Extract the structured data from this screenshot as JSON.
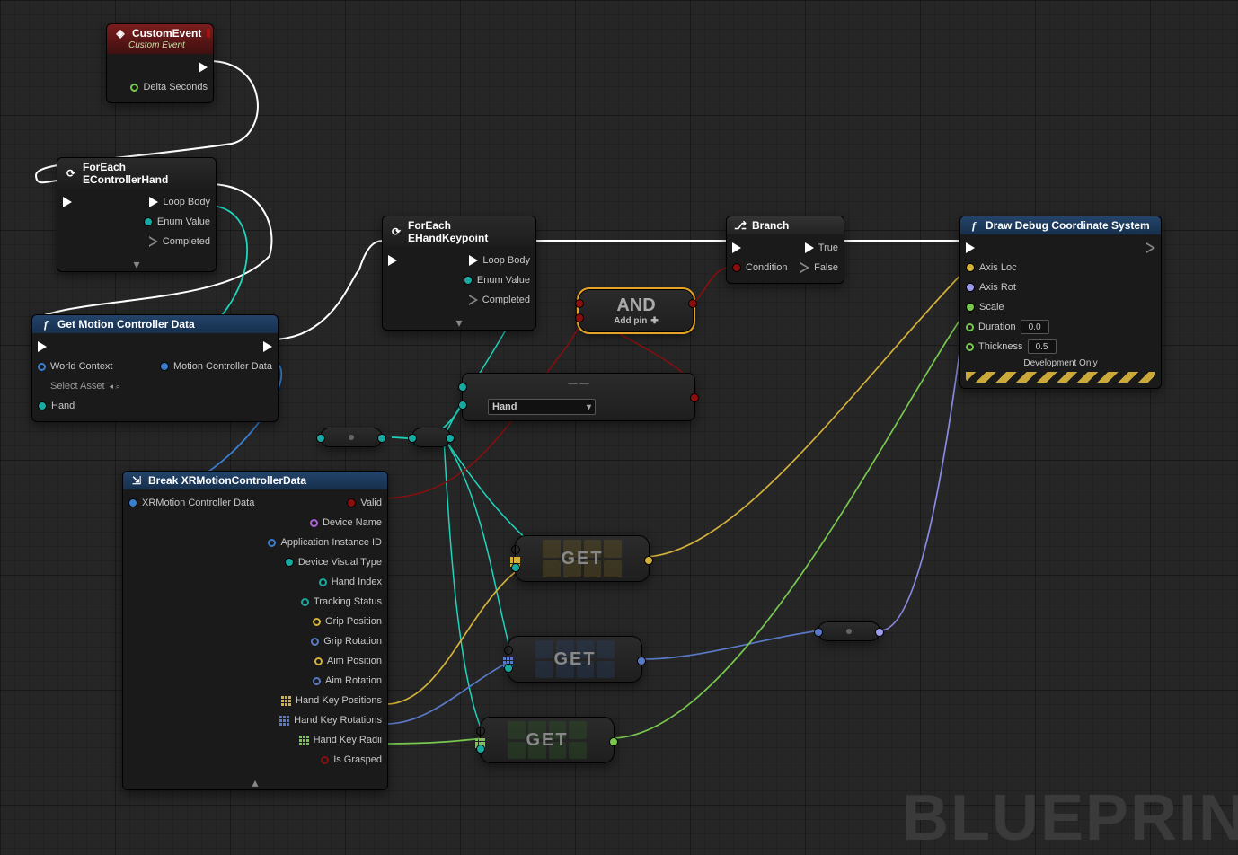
{
  "watermark": "BLUEPRIN",
  "nodes": {
    "customEvent": {
      "title": "CustomEvent",
      "subtitle": "Custom Event",
      "pins": {
        "deltaSeconds": "Delta Seconds"
      }
    },
    "forEachHand": {
      "title": "ForEach EControllerHand",
      "pins": {
        "loopBody": "Loop Body",
        "enumValue": "Enum Value",
        "completed": "Completed"
      }
    },
    "getMotion": {
      "title": "Get Motion Controller Data",
      "pins": {
        "worldContext": "World Context",
        "selectAsset": "Select Asset",
        "hand": "Hand",
        "motionData": "Motion Controller Data"
      }
    },
    "forEachKeypoint": {
      "title": "ForEach EHandKeypoint",
      "pins": {
        "loopBody": "Loop Body",
        "enumValue": "Enum Value",
        "completed": "Completed"
      }
    },
    "branch": {
      "title": "Branch",
      "pins": {
        "condition": "Condition",
        "true": "True",
        "false": "False"
      }
    },
    "and": {
      "title": "AND",
      "addPin": "Add pin"
    },
    "equal": {
      "option": "Hand"
    },
    "break": {
      "title": "Break XRMotionControllerData",
      "pins": {
        "input": "XRMotion Controller Data",
        "valid": "Valid",
        "deviceName": "Device Name",
        "appId": "Application Instance ID",
        "visualType": "Device Visual Type",
        "handIndex": "Hand Index",
        "tracking": "Tracking Status",
        "gripPos": "Grip Position",
        "gripRot": "Grip Rotation",
        "aimPos": "Aim Position",
        "aimRot": "Aim Rotation",
        "handKeyPos": "Hand Key Positions",
        "handKeyRot": "Hand Key Rotations",
        "handKeyRadii": "Hand Key Radii",
        "isGrasped": "Is Grasped"
      }
    },
    "get": {
      "label": "GET"
    },
    "drawDebug": {
      "title": "Draw Debug Coordinate System",
      "pins": {
        "axisLoc": "Axis Loc",
        "axisRot": "Axis Rot",
        "scale": "Scale",
        "duration": "Duration",
        "durationVal": "0.0",
        "thickness": "Thickness",
        "thicknessVal": "0.5",
        "devOnly": "Development Only"
      }
    }
  }
}
